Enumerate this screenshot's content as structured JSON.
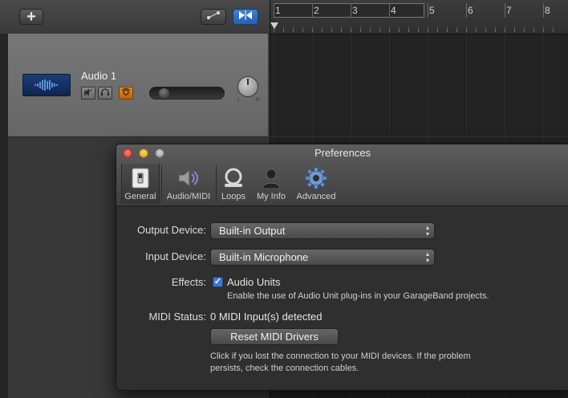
{
  "toolbar": {
    "add_track_label": "+"
  },
  "track": {
    "name": "Audio 1",
    "pan_left": "L",
    "pan_right": "R"
  },
  "ruler": {
    "bars": [
      "1",
      "2",
      "3",
      "4",
      "5",
      "6",
      "7",
      "8"
    ]
  },
  "prefs": {
    "title": "Preferences",
    "tabs": {
      "general": "General",
      "audio_midi": "Audio/MIDI",
      "loops": "Loops",
      "my_info": "My Info",
      "advanced": "Advanced"
    },
    "output_device": {
      "label": "Output Device:",
      "value": "Built-in Output"
    },
    "input_device": {
      "label": "Input Device:",
      "value": "Built-in Microphone"
    },
    "effects": {
      "label": "Effects:",
      "checkbox_label": "Audio Units",
      "checked": true,
      "help": "Enable the use of Audio Unit plug-ins in your GarageBand projects."
    },
    "midi": {
      "label": "MIDI Status:",
      "status": "0 MIDI Input(s) detected",
      "reset_button": "Reset MIDI Drivers",
      "help_line1": "Click if you lost the connection to your MIDI devices. If the problem",
      "help_line2": "persists, check the connection cables."
    }
  },
  "colors": {
    "accent_blue": "#3b78d8",
    "record_orange": "#d07a1c",
    "close_red": "#e0483e",
    "minimize_yellow": "#f0b429"
  }
}
